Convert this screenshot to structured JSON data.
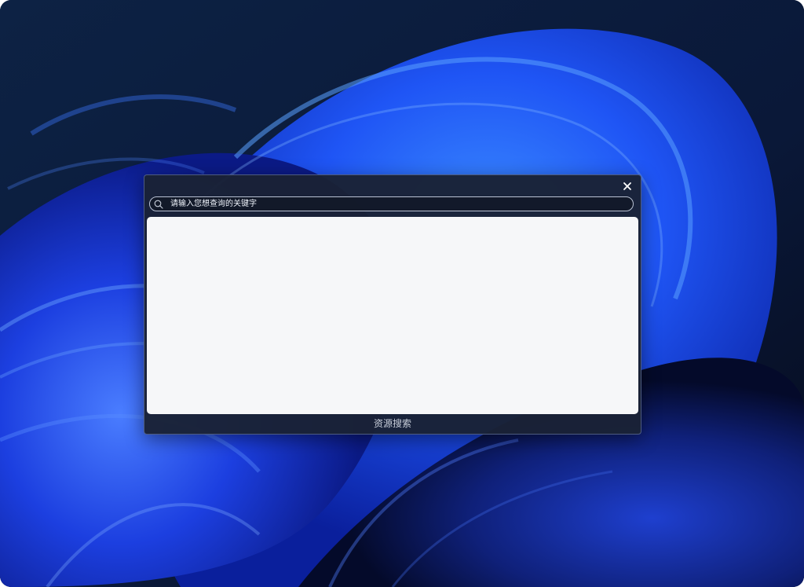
{
  "search": {
    "placeholder": "请输入您想查询的关键字",
    "value": ""
  },
  "dialog": {
    "footer_label": "资源搜索",
    "close_glyph": "✕"
  },
  "icons": {
    "search": "search-icon",
    "close": "close-icon"
  },
  "colors": {
    "dialog_background": "#1a2236",
    "results_background": "#f6f7f9",
    "wallpaper_blue": "#1f4fff"
  }
}
